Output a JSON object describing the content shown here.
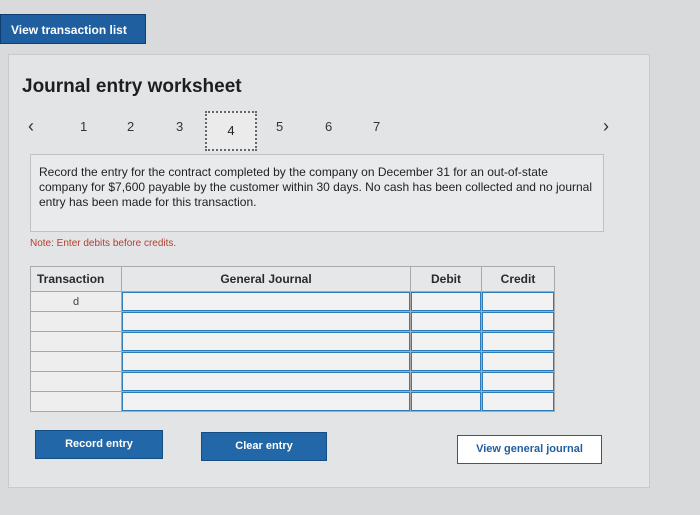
{
  "header": {
    "view_list_label": "View transaction list"
  },
  "worksheet": {
    "title": "Journal entry worksheet",
    "pages": [
      "1",
      "2",
      "3",
      "4",
      "5",
      "6",
      "7"
    ],
    "current_page": "4",
    "instruction": "Record the entry for the contract completed by the company on December 31 for an out-of-state company for $7,600 payable by the customer within 30 days. No cash has been collected and no journal entry has been made for this transaction.",
    "note": "Note: Enter debits before credits."
  },
  "journal": {
    "headers": {
      "transaction": "Transaction",
      "general_journal": "General Journal",
      "debit": "Debit",
      "credit": "Credit"
    },
    "transaction_label": "d",
    "row_count": 6
  },
  "buttons": {
    "record": "Record entry",
    "clear": "Clear entry",
    "view_general": "View general journal"
  },
  "colors": {
    "accent": "#1f5fa0",
    "note": "#b04030"
  }
}
